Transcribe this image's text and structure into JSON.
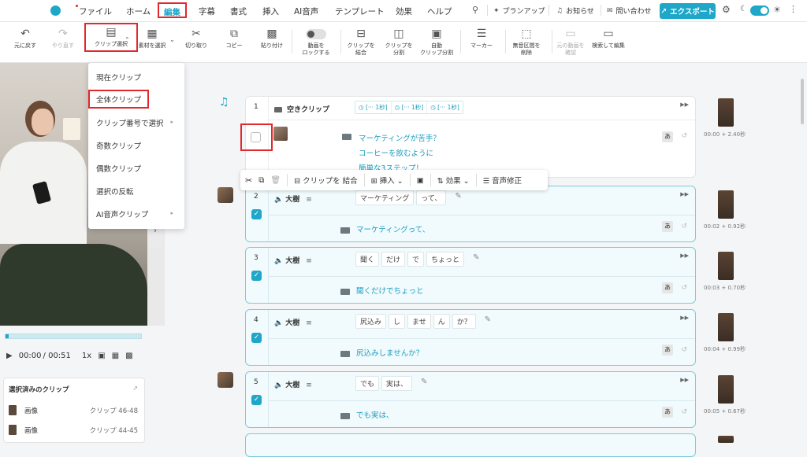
{
  "menu": {
    "file": "ファイル",
    "home": "ホーム",
    "edit": "編集",
    "subtitle": "字幕",
    "style": "書式",
    "insert": "挿入",
    "ai_voice": "AI音声",
    "template": "テンプレート",
    "effect": "効果",
    "help": "ヘルプ"
  },
  "topright": {
    "plan_up": "プランアップ",
    "notice": "お知らせ",
    "contact": "問い合わせ",
    "export": "エクスポート"
  },
  "toolbar": {
    "undo": "元に戻す",
    "redo": "やり直す",
    "clip_select": "クリップ選択",
    "material_select": "素材を選択",
    "cut": "切り取り",
    "copy": "コピー",
    "paste": "貼り付け",
    "lock_video_1": "動画を",
    "lock_video_2": "ロックする",
    "merge_1": "クリップを",
    "merge_2": "結合",
    "split_1": "クリップを",
    "split_2": "分割",
    "auto_split_1": "自動",
    "auto_split_2": "クリップ分割",
    "marker": "マーカー",
    "silence_1": "無音区間を",
    "silence_2": "削除",
    "check_orig_1": "元の動画を",
    "check_orig_2": "確認",
    "search_edit": "検索して編集"
  },
  "dropdown": {
    "current_clip": "現在クリップ",
    "all_clips": "全体クリップ",
    "by_number": "クリップ番号で選択",
    "odd_clips": "奇数クリップ",
    "even_clips": "偶数クリップ",
    "invert": "選択の反転",
    "ai_voice_clip": "AI音声クリップ"
  },
  "player": {
    "current_time": "00:00",
    "total_time": "/ 00:51",
    "speed": "1x",
    "progress": 0.02
  },
  "selected_panel": {
    "title": "選択済みのクリップ",
    "items": [
      {
        "label": "画像",
        "clip": "クリップ 46-48"
      },
      {
        "label": "画像",
        "clip": "クリップ 44-45"
      }
    ]
  },
  "empty_clip": {
    "number": "1",
    "label": "空きクリップ",
    "chips": [
      "[··· 1秒]",
      "[··· 1秒]",
      "[··· 1秒]"
    ],
    "subtitle_lines": [
      "マーケティングが苦手？",
      "コーヒーを飲むように",
      "簡単な3ステップ！"
    ],
    "time": "00:00 + 2.40秒"
  },
  "context_toolbar": {
    "merge": "クリップを 結合",
    "insert": "挿入",
    "effect": "効果",
    "voice_fix": "音声修正"
  },
  "clips": [
    {
      "number": "2",
      "speaker": "大樹",
      "words": [
        "マーケティング",
        "って、"
      ],
      "subtitle": "マーケティングって、",
      "time": "00:02 + 0.92秒"
    },
    {
      "number": "3",
      "speaker": "大樹",
      "words": [
        "聞く",
        "だけ",
        "で",
        "ちょっと"
      ],
      "subtitle": "聞くだけでちょっと",
      "time": "00:03 + 0.70秒"
    },
    {
      "number": "4",
      "speaker": "大樹",
      "words": [
        "尻込み",
        "し",
        "ませ",
        "ん",
        "か？"
      ],
      "subtitle": "尻込みしませんか？",
      "time": "00:04 + 0.99秒"
    },
    {
      "number": "5",
      "speaker": "大樹",
      "words": [
        "でも",
        "実は、"
      ],
      "subtitle": "でも実は、",
      "time": "00:05 + 0.67秒"
    }
  ],
  "a_label": "あ"
}
